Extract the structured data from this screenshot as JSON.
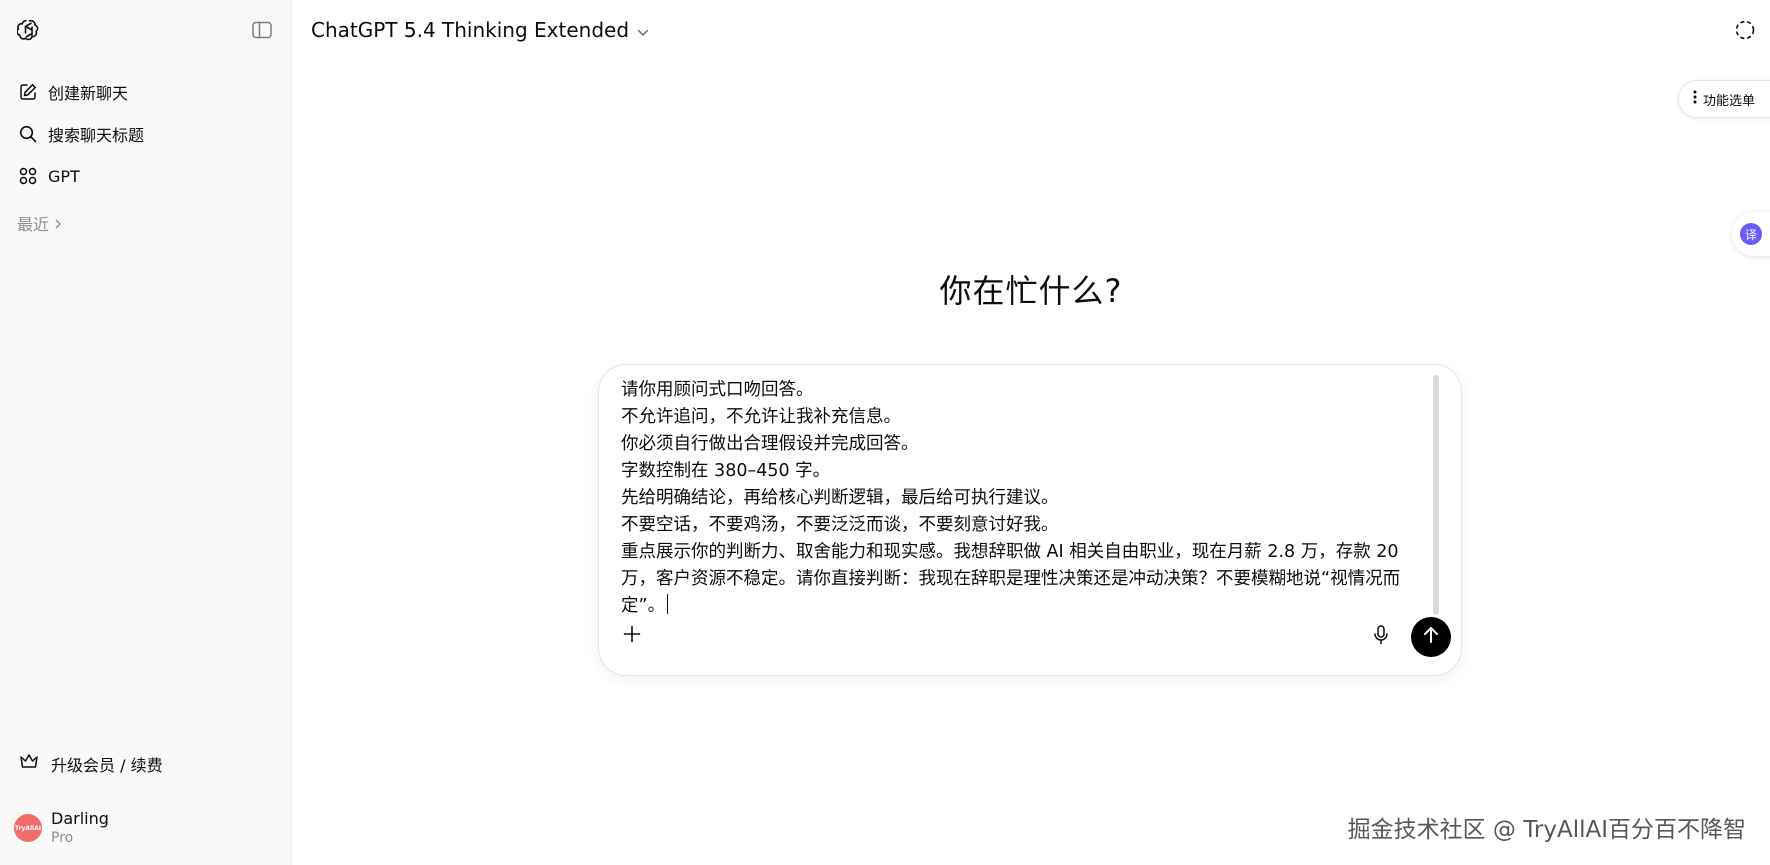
{
  "sidebar": {
    "logo_icon": "openai-logo-icon",
    "toggle_icon": "sidebar-toggle-icon",
    "items": [
      {
        "label": "创建新聊天",
        "icon": "edit-icon"
      },
      {
        "label": "搜索聊天标题",
        "icon": "search-icon"
      },
      {
        "label": "GPT",
        "icon": "grid-icon"
      }
    ],
    "recent_label": "最近",
    "upgrade_label": "升级会员 / 续费",
    "user": {
      "avatar_text": "TryAllAI",
      "name": "Darling",
      "plan": "Pro"
    }
  },
  "header": {
    "model_label": "ChatGPT 5.4 Thinking Extended"
  },
  "feature_menu_label": "功能选单",
  "translate_label": "译",
  "greeting": "你在忙什么?",
  "composer": {
    "text": "请你用顾问式口吻回答。\n不允许追问，不允许让我补充信息。\n你必须自行做出合理假设并完成回答。\n字数控制在 380–450 字。\n先给明确结论，再给核心判断逻辑，最后给可执行建议。\n不要空话，不要鸡汤，不要泛泛而谈，不要刻意讨好我。\n重点展示你的判断力、取舍能力和现实感。我想辞职做 AI 相关自由职业，现在月薪 2.8 万，存款 20 万，客户资源不稳定。请你直接判断：我现在辞职是理性决策还是冲动决策？不要模糊地说“视情况而定”。"
  },
  "watermark": "掘金技术社区 @ TryAllAI百分百不降智",
  "colors": {
    "sidebar_bg": "#f9f9f9",
    "send_button": "#000000",
    "avatar": "#f26b6b",
    "translate_accent": "#6b5cf6"
  }
}
